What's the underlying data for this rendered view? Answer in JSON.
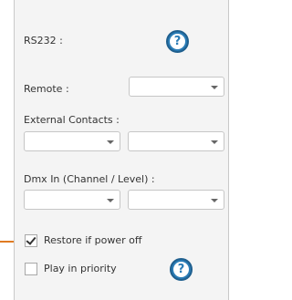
{
  "rs232": {
    "label": "RS232 :"
  },
  "remote": {
    "label": "Remote :",
    "value": ""
  },
  "external_contacts": {
    "label": "External Contacts :",
    "value1": "",
    "value2": ""
  },
  "dmx_in": {
    "label": "Dmx In (Channel / Level) :",
    "channel": "",
    "level": ""
  },
  "restore": {
    "label": "Restore if power off",
    "checked": true
  },
  "play_priority": {
    "label": "Play in priority",
    "checked": false
  },
  "help_glyph": "?",
  "colors": {
    "help_blue": "#2a7cb6",
    "pointer_orange": "#e07b22"
  }
}
